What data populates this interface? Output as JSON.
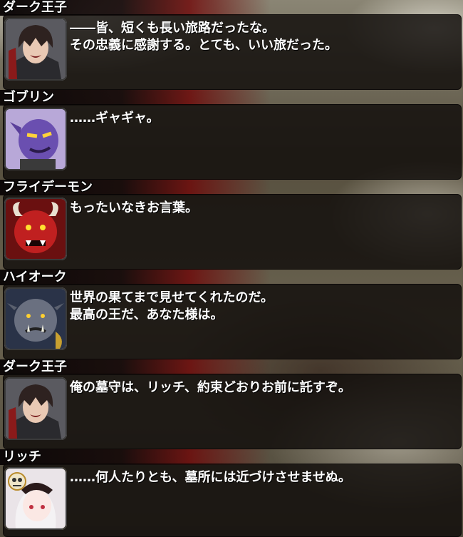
{
  "dialogues": [
    {
      "speaker": "ダーク王子",
      "lines": [
        "――皆、短くも長い旅路だったな。",
        "その忠義に感謝する。とても、いい旅だった。"
      ],
      "portrait": "dark-prince-portrait-icon"
    },
    {
      "speaker": "ゴブリン",
      "lines": [
        "……ギャギャ。"
      ],
      "portrait": "goblin-portrait-icon"
    },
    {
      "speaker": "フライデーモン",
      "lines": [
        "もったいなきお言葉。"
      ],
      "portrait": "fly-demon-portrait-icon"
    },
    {
      "speaker": "ハイオーク",
      "lines": [
        "世界の果てまで見せてくれたのだ。",
        "最高の王だ、あなた様は。"
      ],
      "portrait": "high-orc-portrait-icon"
    },
    {
      "speaker": "ダーク王子",
      "lines": [
        "俺の墓守は、リッチ、約束どおりお前に託すぞ。"
      ],
      "portrait": "dark-prince-portrait-icon"
    },
    {
      "speaker": "リッチ",
      "lines": [
        "……何人たりとも、墓所には近づけさせませぬ。"
      ],
      "portrait": "lich-portrait-icon"
    }
  ]
}
